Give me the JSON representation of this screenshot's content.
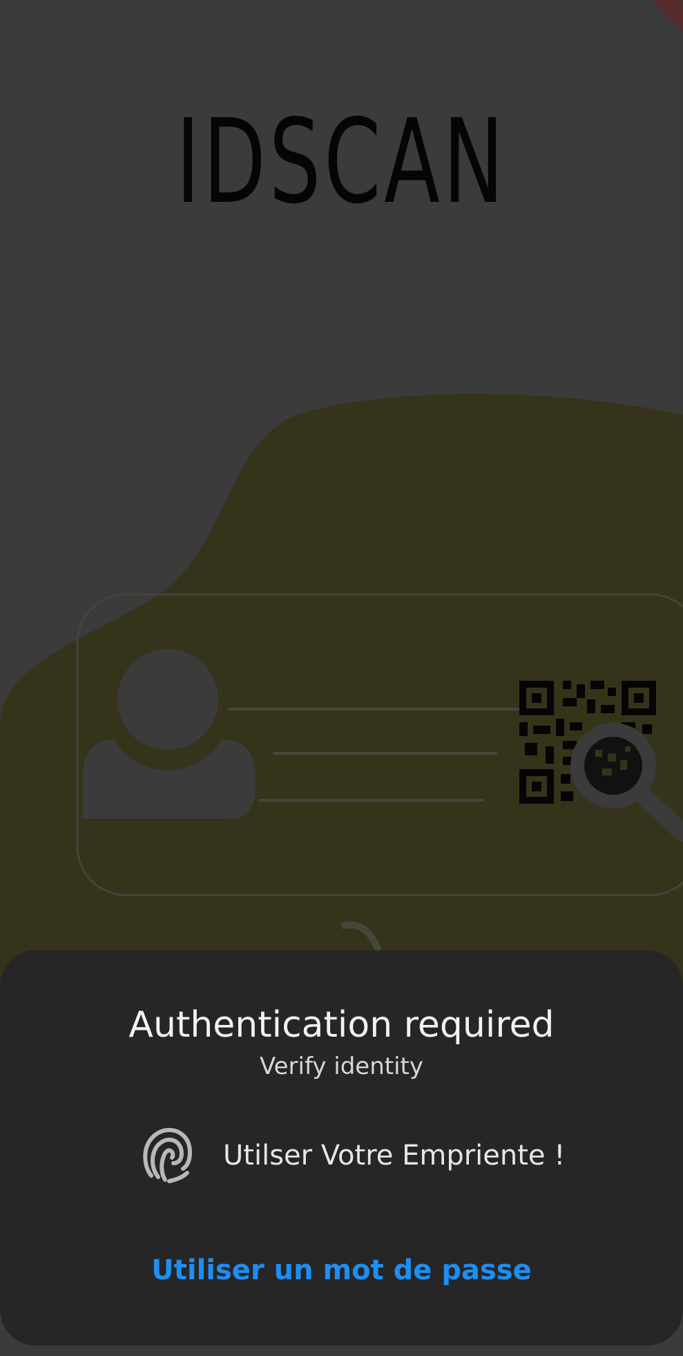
{
  "app": {
    "logo_text": "IDSCAN"
  },
  "auth_dialog": {
    "title": "Authentication required",
    "subtitle": "Verify identity",
    "fingerprint_prompt": "Utilser Votre Empriente !",
    "use_password_label": "Utiliser un mot de passe"
  },
  "colors": {
    "background": "#3b3b3c",
    "blob": "#35331a",
    "sheet": "#262626",
    "accent_link": "#1f8ef1"
  },
  "icons": {
    "fingerprint": "fingerprint-icon",
    "user_card": "id-card-illustration",
    "qr": "qr-code-icon",
    "magnifier": "magnifier-icon"
  }
}
